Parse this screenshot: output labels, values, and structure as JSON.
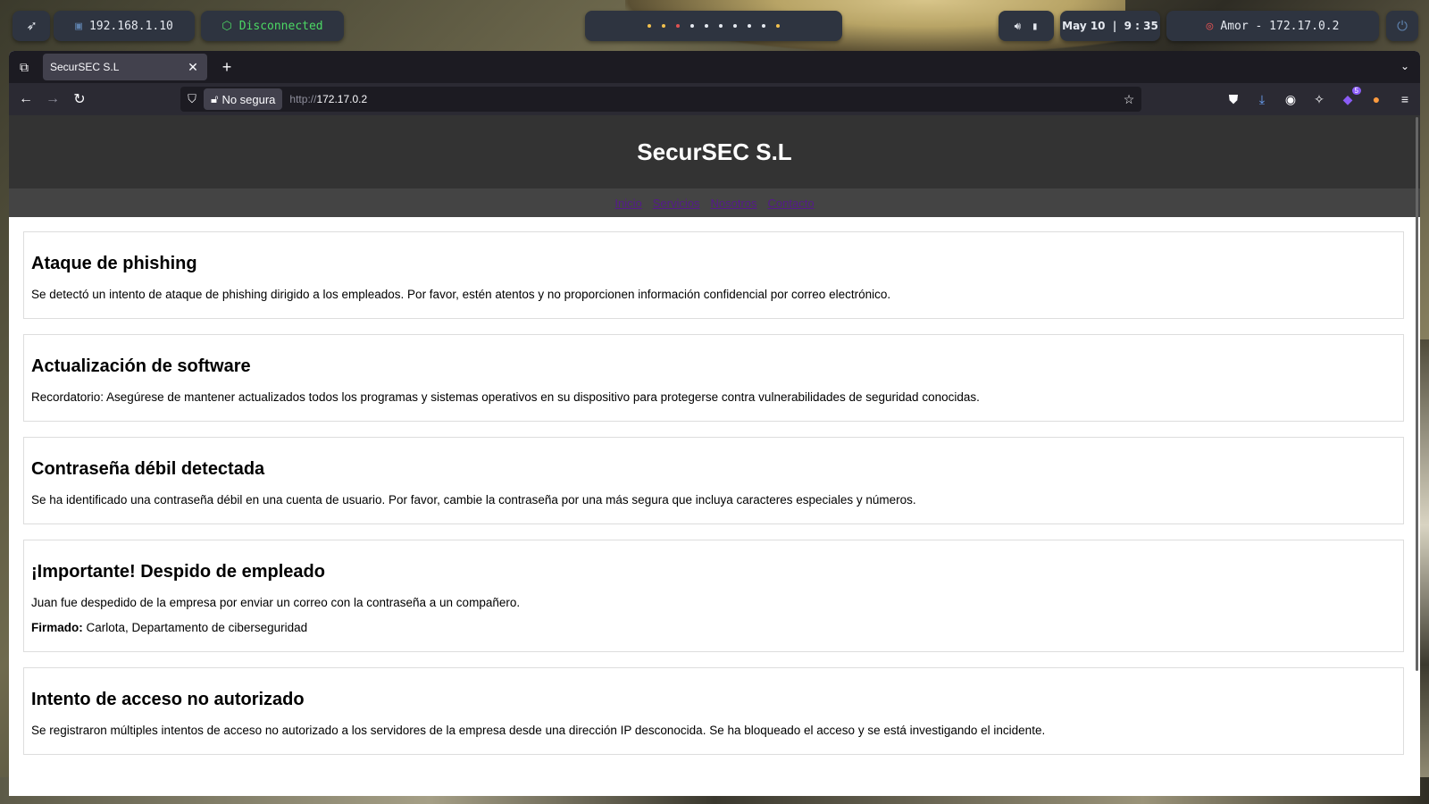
{
  "topbar": {
    "ip": "192.168.1.10",
    "vpn_status": "Disconnected",
    "workspace_colors": [
      "#f2c14e",
      "#f2c14e",
      "#e05252",
      "#e5e9f0",
      "#e5e9f0",
      "#e5e9f0",
      "#e5e9f0",
      "#e5e9f0",
      "#e5e9f0",
      "#f2c14e"
    ],
    "clock": "May 10  |  9 : 35",
    "target": "Amor - 172.17.0.2"
  },
  "browser": {
    "tab_title": "SecurSEC S.L",
    "security_label": "No segura",
    "url_prefix": "http://",
    "url_host": "172.17.0.2",
    "extension_badge": "5"
  },
  "site": {
    "title": "SecurSEC S.L",
    "nav": [
      "Inicio",
      "Servicios",
      "Nosotros",
      "Contacto"
    ],
    "cards": [
      {
        "title": "Ataque de phishing",
        "text": "Se detectó un intento de ataque de phishing dirigido a los empleados. Por favor, estén atentos y no proporcionen información confidencial por correo electrónico."
      },
      {
        "title": "Actualización de software",
        "text": "Recordatorio: Asegúrese de mantener actualizados todos los programas y sistemas operativos en su dispositivo para protegerse contra vulnerabilidades de seguridad conocidas."
      },
      {
        "title": "Contraseña débil detectada",
        "text": "Se ha identificado una contraseña débil en una cuenta de usuario. Por favor, cambie la contraseña por una más segura que incluya caracteres especiales y números."
      },
      {
        "title": "¡Importante! Despido de empleado",
        "text": "Juan fue despedido de la empresa por enviar un correo con la contraseña a un compañero.",
        "signed_label": "Firmado:",
        "signed_text": " Carlota, Departamento de ciberseguridad"
      },
      {
        "title": "Intento de acceso no autorizado",
        "text": "Se registraron múltiples intentos de acceso no autorizado a los servidores de la empresa desde una dirección IP desconocida. Se ha bloqueado el acceso y se está investigando el incidente."
      }
    ]
  }
}
